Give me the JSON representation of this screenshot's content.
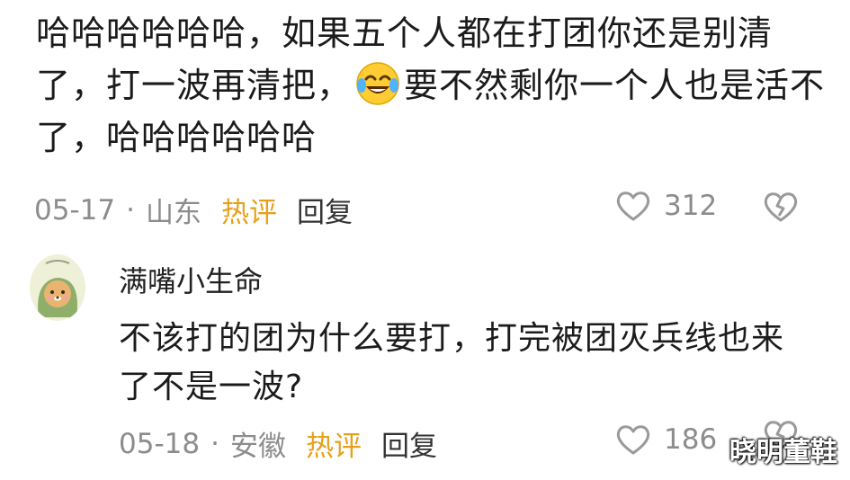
{
  "comment": {
    "text_part1": "哈哈哈哈哈哈，如果五个人都在打团你还是别清了，打一波再清把，",
    "emoji": "face-with-tears-of-joy-icon",
    "text_part2": "要不然剩你一个人也是活不了，哈哈哈哈哈哈",
    "date": "05-17",
    "location": "山东",
    "hot_label": "热评",
    "reply_label": "回复",
    "likes": "312"
  },
  "reply": {
    "username": "满嘴小生命",
    "avatar": "avatar-cartoon-dog-icon",
    "text": "不该打的团为什么要打，打完被团灭兵线也来了不是一波?",
    "date": "05-18",
    "location": "安徽",
    "hot_label": "热评",
    "reply_label": "回复",
    "likes": "186"
  },
  "separator": "·",
  "watermark": "晓明董鞋",
  "colors": {
    "hot": "#e6a01a",
    "meta": "#8c8c8c",
    "text": "#1b1b1b"
  }
}
